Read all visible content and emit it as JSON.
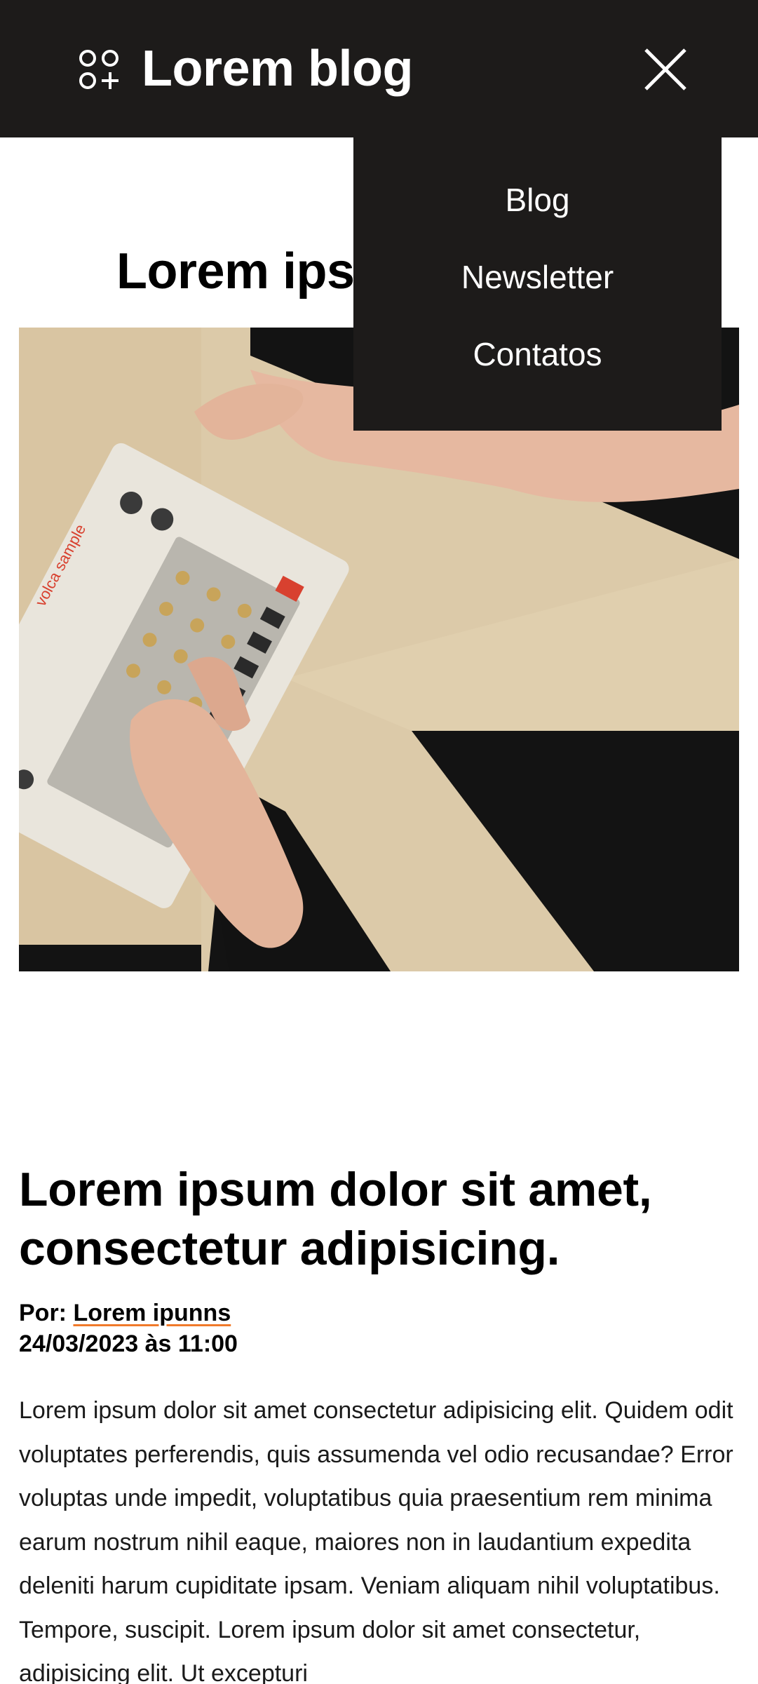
{
  "header": {
    "brand": "Lorem blog",
    "logo_icon": "apps-plus-icon",
    "close_icon": "close-icon",
    "background": "#1d1b1a"
  },
  "menu": {
    "items": [
      {
        "label": "Blog"
      },
      {
        "label": "Newsletter"
      },
      {
        "label": "Contatos"
      }
    ]
  },
  "hero": {
    "title": "Lorem ipsum dolor"
  },
  "article": {
    "title": "Lorem ipsum dolor sit amet, consectetur adipisicing.",
    "by_label": "Por:",
    "author": "Lorem ipunns",
    "date": "24/03/2023 às 11:00",
    "body": "Lorem ipsum dolor sit amet consectetur adipisicing elit. Quidem odit voluptates perferendis, quis assumenda vel odio recusandae? Error voluptas unde impedit, voluptatibus quia praesentium rem minima earum nostrum nihil eaque, maiores non in laudantium expedita deleniti harum cupiditate ipsam. Veniam aliquam nihil voluptatibus. Tempore, suscipit. Lorem ipsum dolor sit amet consectetur, adipisicing elit. Ut excepturi"
  },
  "colors": {
    "link_underline": "#f07a2a",
    "photo_synth_accent": "#d8412f"
  }
}
